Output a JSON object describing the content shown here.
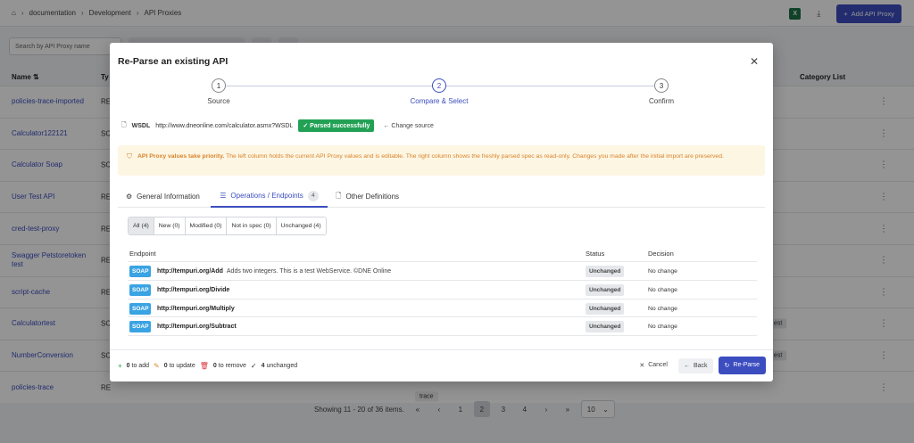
{
  "breadcrumb": {
    "home_icon": "home-icon",
    "items": [
      "documentation",
      "Development",
      "API Proxies"
    ]
  },
  "header": {
    "add_button": "Add API Proxy"
  },
  "search": {
    "placeholder": "Search by API Proxy name"
  },
  "table": {
    "name_header": "Name",
    "type_header": "Ty",
    "category_header": "Category List",
    "rows": [
      {
        "name": "policies-trace-imported",
        "type": "RE"
      },
      {
        "name": "Calculator122121",
        "type": "SC"
      },
      {
        "name": "Calculator Soap",
        "type": "SC"
      },
      {
        "name": "User Test API",
        "type": "RE"
      },
      {
        "name": "cred-test-proxy",
        "type": "RE"
      },
      {
        "name": "Swagger Petstoretoken test",
        "type": "RE"
      },
      {
        "name": "script-cache",
        "type": "RE"
      },
      {
        "name": "Calculatortest",
        "type": "SC",
        "tag": "est"
      },
      {
        "name": "NumberConversion",
        "type": "SC",
        "tag": "est"
      },
      {
        "name": "policies-trace",
        "type": "RE",
        "tag": "trace"
      }
    ]
  },
  "pagination": {
    "summary": "Showing 11 - 20 of 36 items.",
    "first": "«",
    "prev": "‹",
    "pages": [
      "1",
      "2",
      "3",
      "4"
    ],
    "active_page": "2",
    "next": "›",
    "last": "»",
    "page_size": "10"
  },
  "modal": {
    "title": "Re-Parse an existing API",
    "steps": [
      {
        "number": "1",
        "label": "Source"
      },
      {
        "number": "2",
        "label": "Compare & Select"
      },
      {
        "number": "3",
        "label": "Confirm"
      }
    ],
    "source": {
      "type": "WSDL",
      "url": "http://www.dneonline.com/calculator.asmx?WSDL",
      "status": "✓ Parsed successfully",
      "change_label": "Change source"
    },
    "warning": {
      "bold": "API Proxy values take priority.",
      "text": " The left column holds the current API Proxy values and is editable. The right column shows the freshly parsed spec as read-only. Changes you made after the initial import are preserved."
    },
    "tabs": {
      "general": "General Information",
      "operations": "Operations / Endpoints",
      "operations_count": "4",
      "other": "Other Definitions"
    },
    "filters": [
      "All (4)",
      "New (0)",
      "Modified (0)",
      "Not in spec (0)",
      "Unchanged (4)"
    ],
    "endpoint_table": {
      "col_endpoint": "Endpoint",
      "col_status": "Status",
      "col_decision": "Decision",
      "rows": [
        {
          "protocol": "SOAP",
          "url": "http://tempuri.org/Add",
          "desc": "Adds two integers. This is a test WebService. ©DNE Online",
          "status": "Unchanged",
          "decision": "No change"
        },
        {
          "protocol": "SOAP",
          "url": "http://tempuri.org/Divide",
          "desc": "",
          "status": "Unchanged",
          "decision": "No change"
        },
        {
          "protocol": "SOAP",
          "url": "http://tempuri.org/Multiply",
          "desc": "",
          "status": "Unchanged",
          "decision": "No change"
        },
        {
          "protocol": "SOAP",
          "url": "http://tempuri.org/Subtract",
          "desc": "",
          "status": "Unchanged",
          "decision": "No change"
        }
      ]
    },
    "footer": {
      "add_count": "0",
      "add_label": "to add",
      "update_count": "0",
      "update_label": "to update",
      "remove_count": "0",
      "remove_label": "to remove",
      "unchanged_count": "4",
      "unchanged_label": "unchanged",
      "cancel": "Cancel",
      "back": "Back",
      "reparse": "Re-Parse"
    }
  },
  "colors": {
    "accent": "#3b4dbf",
    "success": "#22a155",
    "warning": "#d9822b",
    "soap": "#3aa3e3"
  }
}
